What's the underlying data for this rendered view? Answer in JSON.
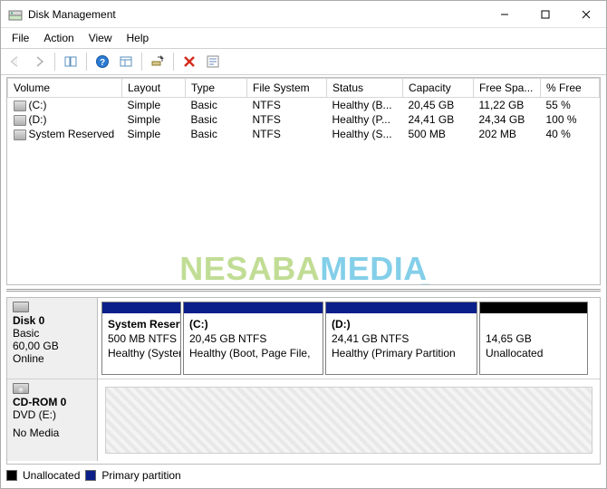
{
  "title": "Disk Management",
  "menu": {
    "file": "File",
    "action": "Action",
    "view": "View",
    "help": "Help"
  },
  "columns": {
    "volume": "Volume",
    "layout": "Layout",
    "type": "Type",
    "fs": "File System",
    "status": "Status",
    "capacity": "Capacity",
    "free": "Free Spa...",
    "pfree": "% Free"
  },
  "volumes": [
    {
      "name": "(C:)",
      "layout": "Simple",
      "type": "Basic",
      "fs": "NTFS",
      "status": "Healthy (B...",
      "capacity": "20,45 GB",
      "free": "11,22 GB",
      "pfree": "55 %"
    },
    {
      "name": "(D:)",
      "layout": "Simple",
      "type": "Basic",
      "fs": "NTFS",
      "status": "Healthy (P...",
      "capacity": "24,41 GB",
      "free": "24,34 GB",
      "pfree": "100 %"
    },
    {
      "name": "System Reserved",
      "layout": "Simple",
      "type": "Basic",
      "fs": "NTFS",
      "status": "Healthy (S...",
      "capacity": "500 MB",
      "free": "202 MB",
      "pfree": "40 %"
    }
  ],
  "disk0": {
    "title": "Disk 0",
    "type": "Basic",
    "size": "60,00 GB",
    "state": "Online",
    "parts": [
      {
        "name": "System Reserved",
        "size": "500 MB NTFS",
        "status": "Healthy (System",
        "stripe": "primary",
        "w": 88
      },
      {
        "name": "(C:)",
        "size": "20,45 GB NTFS",
        "status": "Healthy (Boot, Page File,",
        "stripe": "primary",
        "w": 155
      },
      {
        "name": "(D:)",
        "size": "24,41 GB NTFS",
        "status": "Healthy (Primary Partition",
        "stripe": "primary",
        "w": 168
      },
      {
        "name": "",
        "size": "14,65 GB",
        "status": "Unallocated",
        "stripe": "unalloc",
        "w": 120
      }
    ]
  },
  "cdrom": {
    "title": "CD-ROM 0",
    "type": "DVD (E:)",
    "state": "No Media"
  },
  "legend": {
    "unalloc": "Unallocated",
    "primary": "Primary partition"
  },
  "watermark": {
    "a": "NESABA",
    "b": "MEDIA"
  },
  "colors": {
    "primary": "#0b1f8a",
    "unalloc": "#000000"
  }
}
